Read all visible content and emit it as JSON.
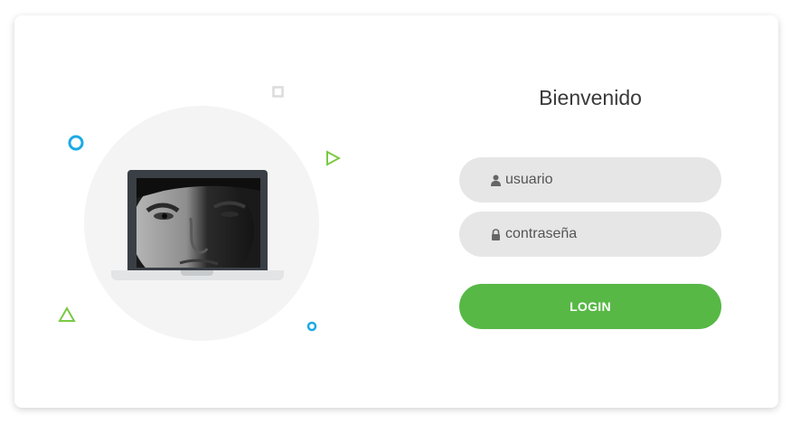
{
  "login": {
    "title": "Bienvenido",
    "username": {
      "placeholder": "usuario",
      "value": "",
      "icon": "user-icon"
    },
    "password": {
      "placeholder": "contraseña",
      "value": "",
      "icon": "lock-icon"
    },
    "submit_label": "LOGIN"
  },
  "illustration": {
    "device": "laptop",
    "screen_content": "photo"
  },
  "colors": {
    "accent_green": "#57b846",
    "accent_blue": "#1aa9e5",
    "field_bg": "#e6e6e6",
    "circle_bg": "#f4f4f4",
    "laptop_body": "#3a3f46"
  }
}
